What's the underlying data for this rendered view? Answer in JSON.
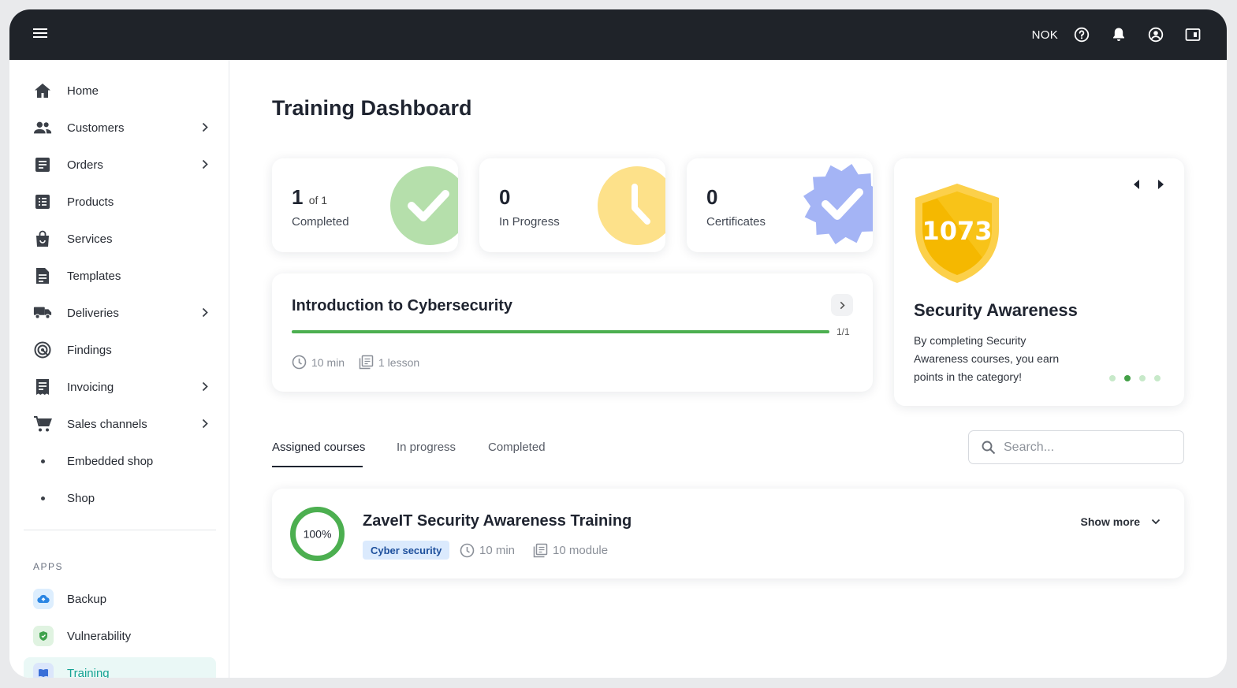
{
  "topbar": {
    "currency": "NOK"
  },
  "sidebar": {
    "items": [
      {
        "label": "Home"
      },
      {
        "label": "Customers"
      },
      {
        "label": "Orders"
      },
      {
        "label": "Products"
      },
      {
        "label": "Services"
      },
      {
        "label": "Templates"
      },
      {
        "label": "Deliveries"
      },
      {
        "label": "Findings"
      },
      {
        "label": "Invoicing"
      },
      {
        "label": "Sales channels"
      },
      {
        "label": "Embedded shop"
      },
      {
        "label": "Shop"
      }
    ],
    "apps_label": "APPS",
    "apps": [
      {
        "label": "Backup"
      },
      {
        "label": "Vulnerability"
      },
      {
        "label": "Training"
      }
    ]
  },
  "page": {
    "title": "Training Dashboard"
  },
  "stats": {
    "completed": {
      "value": "1",
      "of": "of 1",
      "label": "Completed"
    },
    "in_progress": {
      "value": "0",
      "label": "In Progress"
    },
    "certificates": {
      "value": "0",
      "label": "Certificates"
    }
  },
  "current_course": {
    "title": "Introduction to Cybersecurity",
    "progress_fraction": 1.0,
    "progress_label": "1/1",
    "duration": "10 min",
    "lessons": "1 lesson"
  },
  "awareness": {
    "points": "1073",
    "title": "Security Awareness",
    "description": "By completing Security Awareness courses, you earn points in the category!",
    "active_dot": 1,
    "dot_count": 4
  },
  "tabs": [
    {
      "label": "Assigned courses"
    },
    {
      "label": "In progress"
    },
    {
      "label": "Completed"
    }
  ],
  "search": {
    "placeholder": "Search..."
  },
  "course_row": {
    "percent": "100%",
    "title": "ZaveIT Security Awareness Training",
    "tag": "Cyber security",
    "duration": "10 min",
    "modules": "10 module",
    "show_more": "Show more"
  },
  "colors": {
    "topbar": "#1f2329",
    "accent_green": "#4caf50",
    "active_teal": "#16a394",
    "badge_bg": "#dbeafd",
    "shield_gold": "#f5b800"
  }
}
